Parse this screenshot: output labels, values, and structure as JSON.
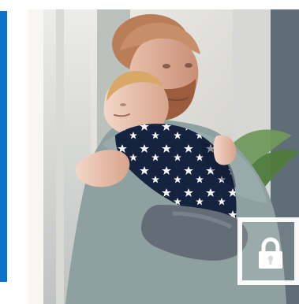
{
  "colors": {
    "accent": "#0a73c9",
    "lock_tile_border": "#ffffff"
  },
  "photo": {
    "description_icon": "hero-photo"
  },
  "overlay": {
    "icon": "lock-icon"
  }
}
